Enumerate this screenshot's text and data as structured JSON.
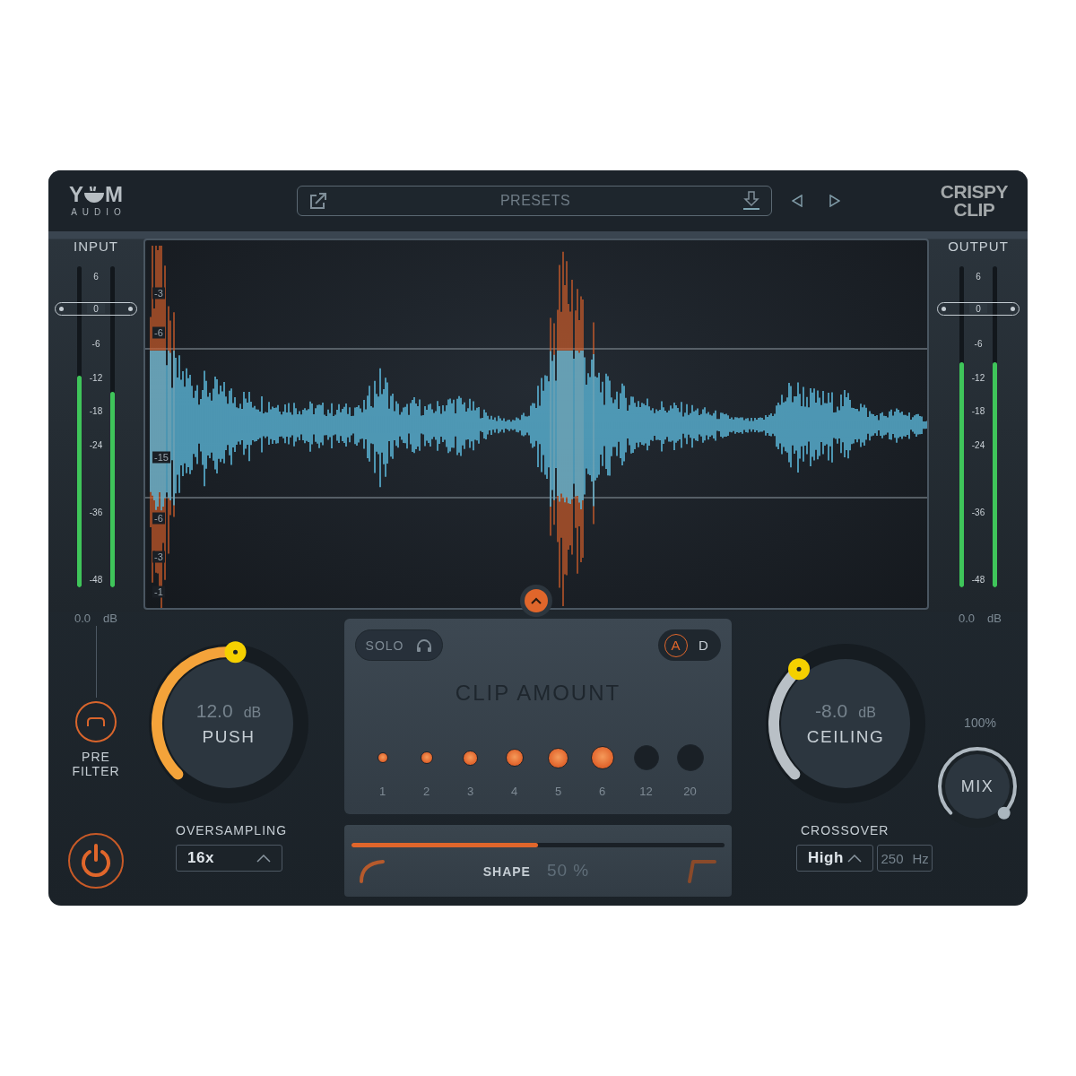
{
  "header": {
    "logo": {
      "left": "Y",
      "right": "M",
      "sub": "AUDIO"
    },
    "presets": {
      "label": "PRESETS"
    },
    "product_logo": [
      "CRISPY",
      "CLIP"
    ]
  },
  "input_meter": {
    "label": "INPUT",
    "scale": [
      "6",
      "0",
      "-6",
      "-12",
      "-18",
      "-24",
      "-36",
      "-48"
    ],
    "channels": [
      {
        "level": 0.66
      },
      {
        "level": 0.61
      }
    ],
    "readout": "0.0",
    "unit": "dB"
  },
  "waveform": {
    "scale": [
      "-3",
      "-6",
      "-15",
      "-6",
      "-3",
      "-1"
    ]
  },
  "output_meter": {
    "label": "OUTPUT",
    "scale": [
      "6",
      "0",
      "-6",
      "-12",
      "-18",
      "-24",
      "-36",
      "-48"
    ],
    "channels": [
      {
        "level": 0.7
      },
      {
        "level": 0.7
      }
    ],
    "readout": "0.0",
    "unit": "dB"
  },
  "pre_filter": {
    "label": "PRE FILTER"
  },
  "power": {
    "on": true
  },
  "push": {
    "value": "12.0",
    "unit": "dB",
    "label": "PUSH"
  },
  "oversampling": {
    "label": "OVERSAMPLING",
    "value": "16x"
  },
  "clip_panel": {
    "solo": {
      "label": "SOLO",
      "on": false
    },
    "modes": [
      {
        "label": "A",
        "selected": true
      },
      {
        "label": "D",
        "selected": false
      }
    ],
    "title": "CLIP AMOUNT",
    "steps": [
      {
        "label": "1",
        "on": true
      },
      {
        "label": "2",
        "on": true
      },
      {
        "label": "3",
        "on": true
      },
      {
        "label": "4",
        "on": true
      },
      {
        "label": "5",
        "on": true
      },
      {
        "label": "6",
        "on": true
      },
      {
        "label": "12",
        "on": false
      },
      {
        "label": "20",
        "on": false
      }
    ]
  },
  "shape": {
    "label": "SHAPE",
    "value": "50 %",
    "level": 0.5
  },
  "ceiling": {
    "value": "-8.0",
    "unit": "dB",
    "label": "CEILING"
  },
  "mix": {
    "reading": "100%",
    "label": "MIX"
  },
  "crossover": {
    "label": "CROSSOVER",
    "value": "High",
    "frequency": "250",
    "unit": "Hz"
  }
}
